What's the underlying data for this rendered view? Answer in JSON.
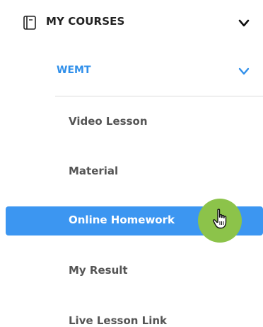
{
  "section": {
    "title": "MY COURSES",
    "icon": "book-icon",
    "toggle_icon": "chevron-down-icon"
  },
  "course": {
    "title": "WEMT",
    "toggle_icon": "chevron-down-icon",
    "accent_color": "#2f8fea"
  },
  "items": [
    {
      "label": "Video Lesson",
      "active": false
    },
    {
      "label": "Material",
      "active": false
    },
    {
      "label": "Online Homework",
      "active": true
    },
    {
      "label": "My Result",
      "active": false
    },
    {
      "label": "Live Lesson Link",
      "active": false
    }
  ],
  "colors": {
    "active_bg": "#3c96f1",
    "cursor_highlight": "#8cc34a",
    "text": "#555555"
  },
  "cursor": {
    "icon": "hand-pointer-icon"
  }
}
